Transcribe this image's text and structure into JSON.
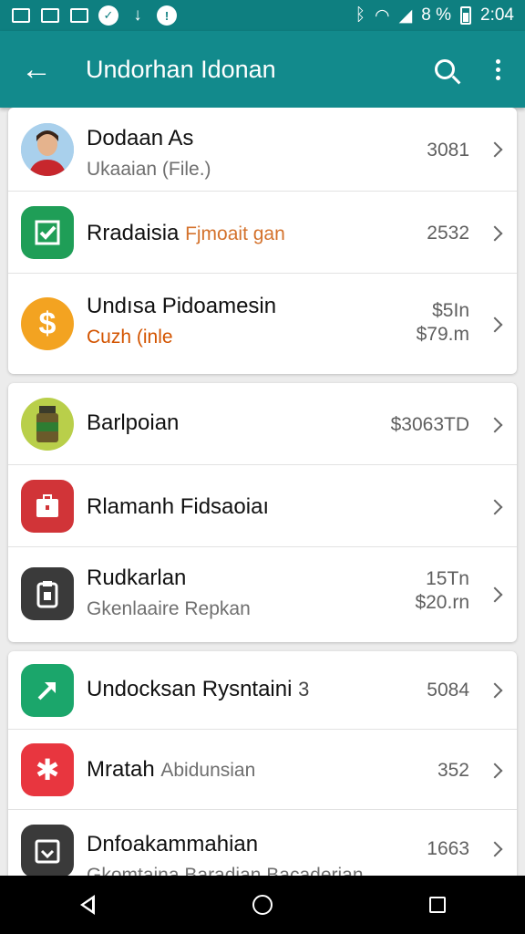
{
  "status_bar": {
    "battery": "8 %",
    "time": "2:04"
  },
  "app_bar": {
    "title": "Undorhan Idonan"
  },
  "sections": [
    {
      "rows": [
        {
          "title": "Dodaan As",
          "subtitle": "Ukaaian (File.)",
          "values": [
            "3081"
          ],
          "icon": "avatar-photo",
          "color": "#9fc8e8"
        },
        {
          "title": "Rradaisia",
          "inline": "Fjmoait gan",
          "values": [
            "2532"
          ],
          "icon": "check-icon",
          "color": "#1f9e57"
        },
        {
          "title": "Undısa Pidoamesin",
          "subtitle": "Cuzh (inle",
          "values": [
            "$5In",
            "$79.m"
          ],
          "icon": "dollar-icon",
          "color": "#f3a321"
        }
      ]
    },
    {
      "rows": [
        {
          "title": "Barlpoian",
          "values": [
            "$3063TD"
          ],
          "icon": "jar-icon",
          "color": "#b9cf4a"
        },
        {
          "title": "Rlamanh Fidsaoiaı",
          "values": [],
          "icon": "briefcase-icon",
          "color": "#d13438"
        },
        {
          "title": "Rudkarlan",
          "subtitle": "Gkenlaaire Repkan",
          "values": [
            "15Tn",
            "$20.rn"
          ],
          "icon": "clipboard-icon",
          "color": "#3a3a3a"
        }
      ]
    },
    {
      "rows": [
        {
          "title": "Undocksan Rysntaini",
          "inline": "3",
          "values": [
            "5084"
          ],
          "icon": "arrow-icon",
          "color": "#1ba66b"
        },
        {
          "title": "Mratah",
          "inline": "Abidunsian",
          "values": [
            "352"
          ],
          "icon": "gear-icon",
          "color": "#e8363f"
        },
        {
          "title": "Dnfoakammahian",
          "subtitle": "Gkomtaina Baradian Bacaderian",
          "values": [
            "1663"
          ],
          "icon": "download-icon",
          "color": "#3a3a3a"
        }
      ]
    }
  ]
}
